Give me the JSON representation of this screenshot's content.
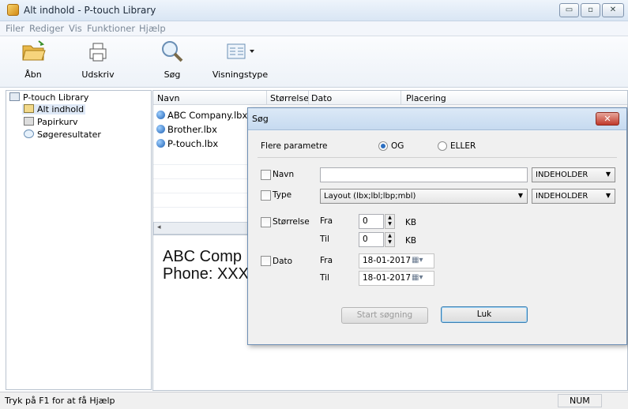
{
  "window": {
    "title": "Alt indhold - P-touch Library",
    "controls": {
      "minimize": "▭",
      "maximize": "▫",
      "close": "✕"
    }
  },
  "menu": [
    "Filer",
    "Rediger",
    "Vis",
    "Funktioner",
    "Hjælp"
  ],
  "toolbar": {
    "open_label": "Åbn",
    "print_label": "Udskriv",
    "search_label": "Søg",
    "view_label": "Visningstype"
  },
  "tree": {
    "root": "P-touch Library",
    "items": [
      "Alt indhold",
      "Papirkurv",
      "Søgeresultater"
    ]
  },
  "filelist": {
    "columns": [
      "Navn",
      "Størrelse",
      "Dato",
      "Placering"
    ],
    "rows": [
      "ABC Company.lbx",
      "Brother.lbx",
      "P-touch.lbx"
    ],
    "edge_fragments": [
      "BC",
      "ot",
      "to"
    ]
  },
  "preview": {
    "lines": "ABC Comp\nPhone: XXX"
  },
  "status": {
    "text": "Tryk på F1 for at få Hjælp",
    "num": "NUM"
  },
  "dialog": {
    "title": "Søg",
    "close": "✕",
    "more_params": "Flere parametre",
    "og_label": "OG",
    "eller_label": "ELLER",
    "name_label": "Navn",
    "name_value": "",
    "name_mode": "INDEHOLDER",
    "type_label": "Type",
    "type_value": "Layout (lbx;lbl;lbp;mbl)",
    "type_mode": "INDEHOLDER",
    "size_label": "Størrelse",
    "from_label": "Fra",
    "to_label": "Til",
    "size_from": "0",
    "size_to": "0",
    "size_unit": "KB",
    "date_label": "Dato",
    "date_from_label": "Fra",
    "date_to_label": "Til",
    "date_from": "18-01-2017",
    "date_to": "18-01-2017",
    "start_button": "Start søgning",
    "close_button": "Luk",
    "dropdown_arrow": "▼"
  }
}
